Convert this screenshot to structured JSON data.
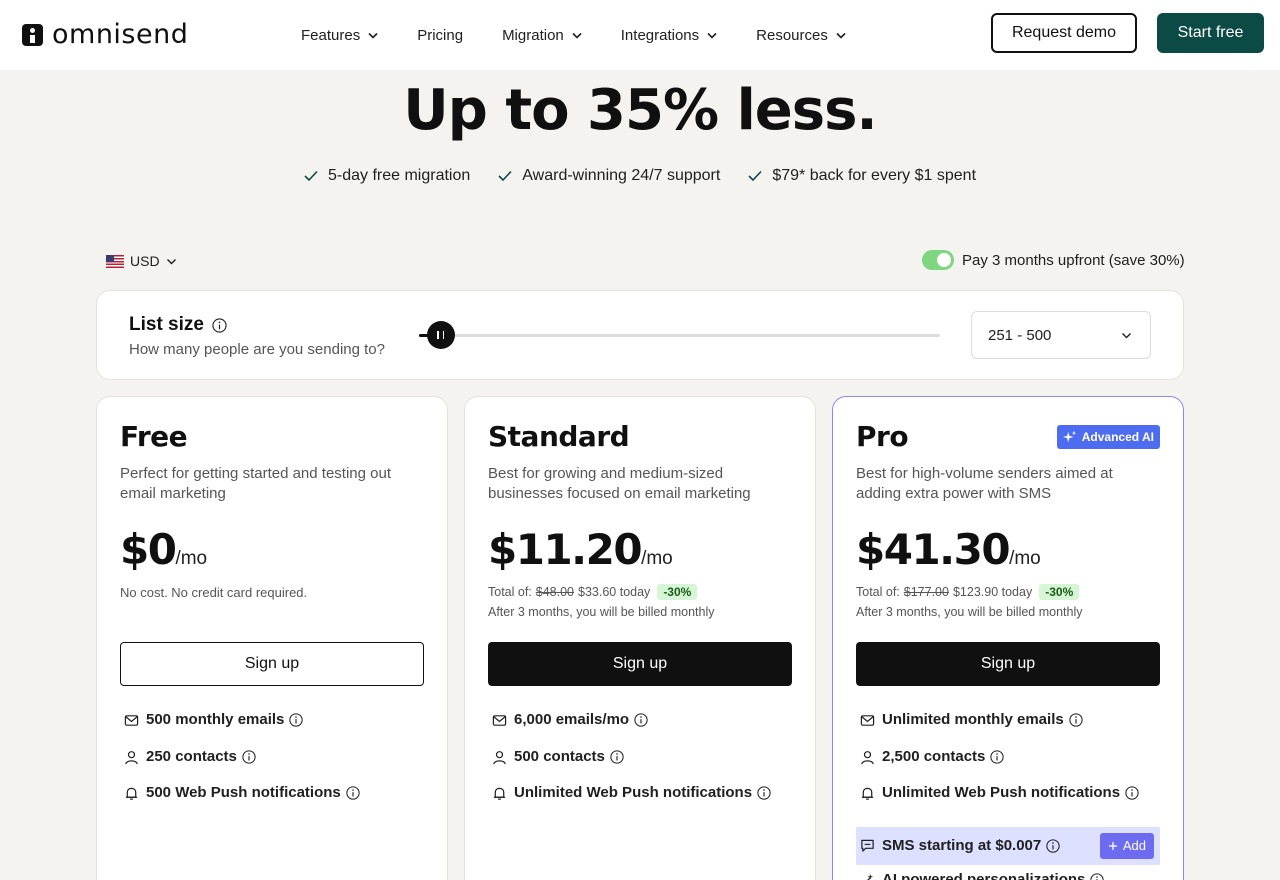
{
  "header": {
    "logo_text": "omnisend",
    "menu": [
      {
        "label": "Features",
        "has_dropdown": true
      },
      {
        "label": "Pricing",
        "has_dropdown": false
      },
      {
        "label": "Migration",
        "has_dropdown": true
      },
      {
        "label": "Integrations",
        "has_dropdown": true
      },
      {
        "label": "Resources",
        "has_dropdown": true
      }
    ],
    "request_demo": "Request demo",
    "start_free": "Start free"
  },
  "hero": {
    "title_line": "Up to 35% less.",
    "benefits": [
      "5-day free migration",
      "Award-winning 24/7 support",
      "$79* back for every $1 spent"
    ]
  },
  "controls": {
    "currency": "USD",
    "toggle_label": "Pay 3 months upfront (save 30%)",
    "toggle_on": true
  },
  "list_size": {
    "title": "List size",
    "subtitle": "How many people are you sending to?",
    "selected_range": "251 - 500",
    "slider_fraction": 0.042
  },
  "plans": [
    {
      "name": "Free",
      "description": "Perfect for getting started and testing out email marketing",
      "price": "$0",
      "unit": "/mo",
      "note": "No cost. No credit card required.",
      "cta": "Sign up",
      "features": [
        "500 monthly emails",
        "250 contacts",
        "500 Web Push notifications"
      ]
    },
    {
      "name": "Standard",
      "description": "Best for growing and medium-sized businesses focused on email marketing",
      "price": "$11.20",
      "unit": "/mo",
      "total_label": "Total of:",
      "original_total": "$48.00",
      "today_total": "$33.60 today",
      "discount": "-30%",
      "billing_note": "After 3 months, you will be billed monthly",
      "cta": "Sign up",
      "features": [
        "6,000 emails/mo",
        "500 contacts",
        "Unlimited Web Push notifications"
      ]
    },
    {
      "name": "Pro",
      "badge": "Advanced AI",
      "description": "Best for high-volume senders aimed at adding extra power with SMS",
      "price": "$41.30",
      "unit": "/mo",
      "total_label": "Total of:",
      "original_total": "$177.00",
      "today_total": "$123.90 today",
      "discount": "-30%",
      "billing_note": "After 3 months, you will be billed monthly",
      "cta": "Sign up",
      "features": [
        "Unlimited monthly emails",
        "2,500 contacts",
        "Unlimited Web Push notifications"
      ],
      "sms_feature": "SMS starting at $0.007",
      "sms_add": "Add",
      "ai_feature": "AI powered personalizations"
    }
  ],
  "colors": {
    "page_bg": "#f4f3ef",
    "brand_dark_green": "#0c4a45",
    "toggle_green": "#7fd680",
    "ai_badge_blue": "#4d6cf0",
    "pro_border": "#8d88e6",
    "sms_highlight": "#dde0ff",
    "discount_bg": "#d5f5d5"
  },
  "icons": {
    "email": "envelope-icon",
    "contacts": "person-icon",
    "push": "bell-icon",
    "sms": "chat-icon",
    "ai": "magic-wand-icon",
    "info": "info-circle-icon",
    "check": "check-icon"
  }
}
